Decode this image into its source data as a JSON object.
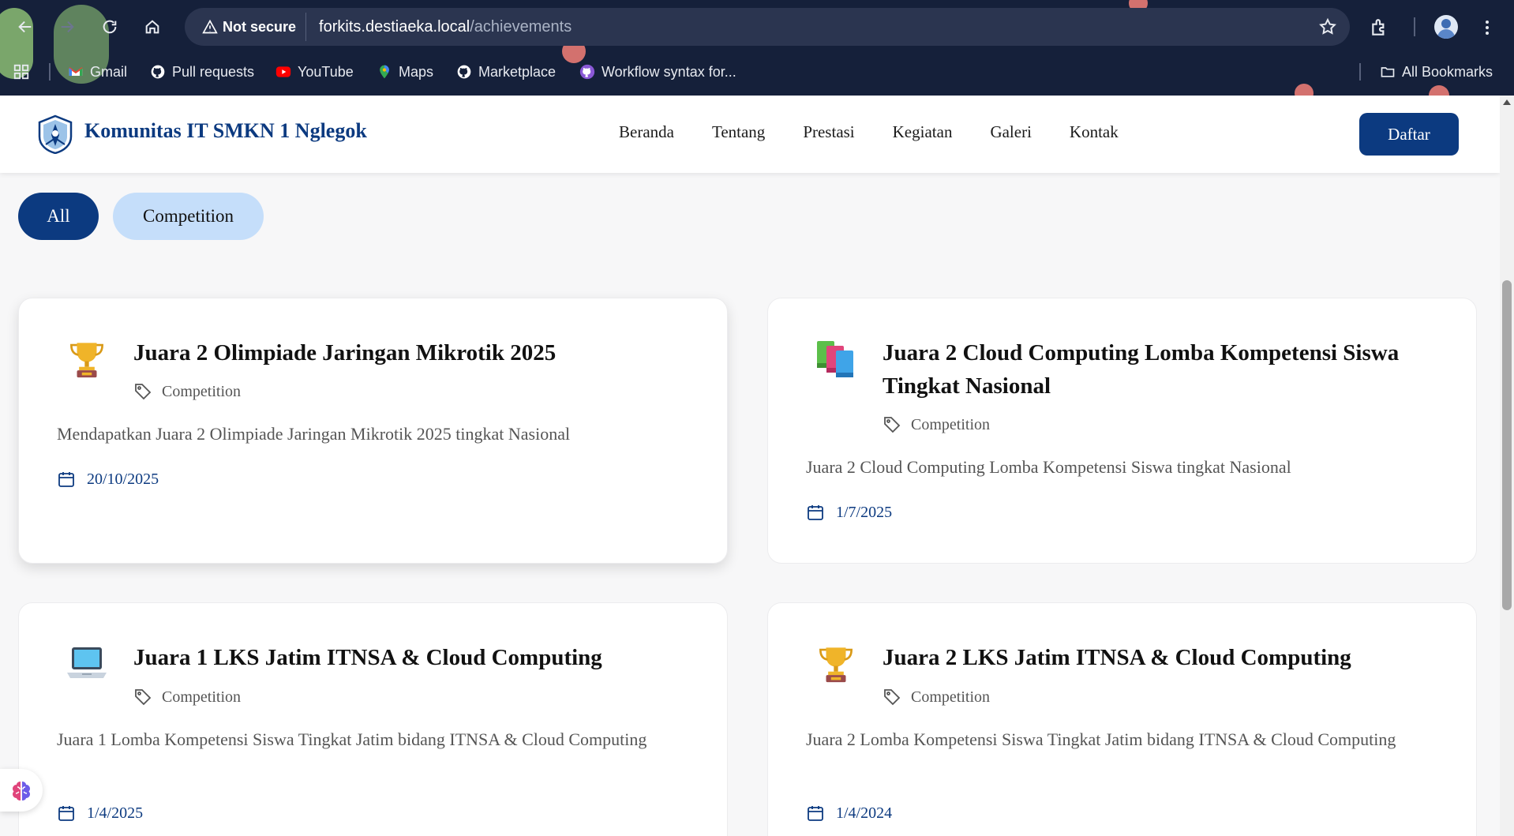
{
  "browser": {
    "security_label": "Not secure",
    "url_host": "forkits.destiaeka.local",
    "url_path": "/achievements",
    "bookmarks": [
      {
        "label": "Gmail",
        "icon": "gmail-icon"
      },
      {
        "label": "Pull requests",
        "icon": "github-icon"
      },
      {
        "label": "YouTube",
        "icon": "youtube-icon"
      },
      {
        "label": "Maps",
        "icon": "maps-icon"
      },
      {
        "label": "Marketplace",
        "icon": "github-icon"
      },
      {
        "label": "Workflow syntax for...",
        "icon": "github-purple-icon"
      }
    ],
    "all_bookmarks": "All Bookmarks"
  },
  "site": {
    "brand": "Komunitas IT SMKN 1 Nglegok",
    "nav": [
      "Beranda",
      "Tentang",
      "Prestasi",
      "Kegiatan",
      "Galeri",
      "Kontak"
    ],
    "cta": "Daftar",
    "colors": {
      "primary": "#0c3a80",
      "pill_alt": "#c5defa"
    }
  },
  "filters": [
    "All",
    "Competition"
  ],
  "achievements": [
    {
      "icon": "trophy-icon",
      "title": "Juara 2 Olimpiade Jaringan Mikrotik 2025",
      "category": "Competition",
      "description": "Mendapatkan Juara 2 Olimpiade Jaringan Mikrotik 2025 tingkat Nasional",
      "date": "20/10/2025"
    },
    {
      "icon": "books-icon",
      "title": "Juara 2 Cloud Computing Lomba Kompetensi Siswa Tingkat Nasional",
      "category": "Competition",
      "description": "Juara 2 Cloud Computing Lomba Kompetensi Siswa tingkat Nasional",
      "date": "1/7/2025"
    },
    {
      "icon": "laptop-icon",
      "title": "Juara 1 LKS Jatim ITNSA & Cloud Computing",
      "category": "Competition",
      "description": "Juara 1 Lomba Kompetensi Siswa Tingkat Jatim bidang ITNSA & Cloud Computing",
      "date": "1/4/2025"
    },
    {
      "icon": "trophy-icon",
      "title": "Juara 2 LKS Jatim ITNSA & Cloud Computing",
      "category": "Competition",
      "description": "Juara 2 Lomba Kompetensi Siswa Tingkat Jatim bidang ITNSA & Cloud Computing",
      "date": "1/4/2024"
    }
  ]
}
